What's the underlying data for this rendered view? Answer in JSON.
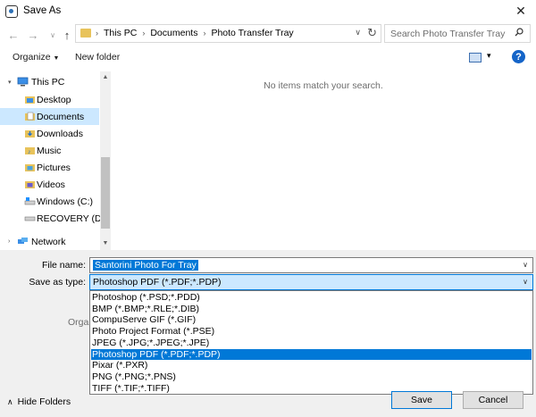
{
  "window": {
    "title": "Save As"
  },
  "address": {
    "breadcrumbs": [
      "This PC",
      "Documents",
      "Photo Transfer Tray"
    ]
  },
  "search": {
    "placeholder": "Search Photo Transfer Tray"
  },
  "toolbar": {
    "organize_label": "Organize",
    "new_folder_label": "New folder",
    "help_label": "?"
  },
  "nav": {
    "items": [
      {
        "label": "This PC",
        "icon": "computer-icon"
      },
      {
        "label": "Desktop",
        "icon": "folder-blue-icon"
      },
      {
        "label": "Documents",
        "icon": "documents-icon",
        "selected": true
      },
      {
        "label": "Downloads",
        "icon": "downloads-icon"
      },
      {
        "label": "Music",
        "icon": "music-icon"
      },
      {
        "label": "Pictures",
        "icon": "pictures-icon"
      },
      {
        "label": "Videos",
        "icon": "videos-icon"
      },
      {
        "label": "Windows (C:)",
        "icon": "drive-icon"
      },
      {
        "label": "RECOVERY (D:)",
        "icon": "drive-icon"
      },
      {
        "label": "Network",
        "icon": "network-icon"
      }
    ]
  },
  "content": {
    "empty_message": "No items match your search."
  },
  "form": {
    "file_name_label": "File name:",
    "file_name_value": "Santorini Photo For Tray",
    "save_type_label": "Save as type:",
    "save_type_value": "Photoshop PDF (*.PDF;*.PDP)",
    "partial_label": "Orga"
  },
  "type_options": [
    "Photoshop (*.PSD;*.PDD)",
    "BMP (*.BMP;*.RLE;*.DIB)",
    "CompuServe GIF (*.GIF)",
    "Photo Project Format (*.PSE)",
    "JPEG (*.JPG;*.JPEG;*.JPE)",
    "Photoshop PDF (*.PDF;*.PDP)",
    "Pixar (*.PXR)",
    "PNG (*.PNG;*.PNS)",
    "TIFF (*.TIF;*.TIFF)"
  ],
  "selected_type_index": 5,
  "footer": {
    "hide_folders_label": "Hide Folders",
    "save_label": "Save",
    "cancel_label": "Cancel"
  },
  "colors": {
    "accent": "#0078d7",
    "selection_light": "#cce8ff",
    "panel_bg": "#f0f0f0"
  }
}
